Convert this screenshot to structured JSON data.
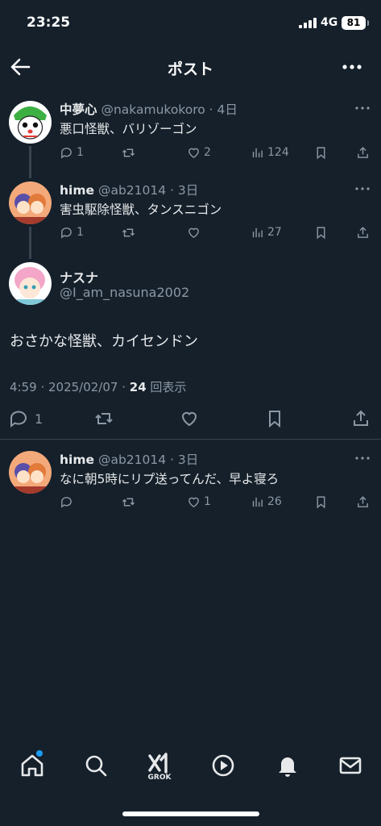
{
  "status_bar": {
    "time": "23:25",
    "network": "4G",
    "battery": "81"
  },
  "header": {
    "title": "ポスト"
  },
  "thread": [
    {
      "name": "中夢心",
      "handle": "@nakamukokoro",
      "time": "· 4日",
      "text": "悪口怪獣、バリゾーゴン",
      "replies": "1",
      "retweets": "",
      "likes": "2",
      "views": "124"
    },
    {
      "name": "hime",
      "handle": "@ab21014",
      "time": "· 3日",
      "text": "害虫駆除怪獣、タンスニゴン",
      "replies": "1",
      "retweets": "",
      "likes": "",
      "views": "27"
    }
  ],
  "main_post": {
    "name": "ナスナ",
    "handle": "@I_am_nasuna2002",
    "text": "おさかな怪獣、カイセンドン",
    "time": "4:59 · 2025/02/07 ·",
    "views": "24",
    "views_label": "回表示",
    "replies": "1"
  },
  "reply": {
    "name": "hime",
    "handle": "@ab21014",
    "time": "· 3日",
    "text": "なに朝5時にリプ送ってんだ、早よ寝ろ",
    "replies": "",
    "retweets": "",
    "likes": "1",
    "views": "26"
  },
  "tabbar": {
    "grok_label": "GROK"
  },
  "icons": {
    "back": "arrow-left-icon",
    "more": "more-horizontal-icon",
    "reply": "speech-bubble-icon",
    "retweet": "retweet-icon",
    "like": "heart-icon",
    "views": "bar-chart-icon",
    "bookmark": "bookmark-icon",
    "share": "share-icon"
  },
  "colors": {
    "background": "#15202b",
    "text": "#e7e9ea",
    "secondary": "#8b98a5",
    "accent": "#1d9bf0"
  }
}
